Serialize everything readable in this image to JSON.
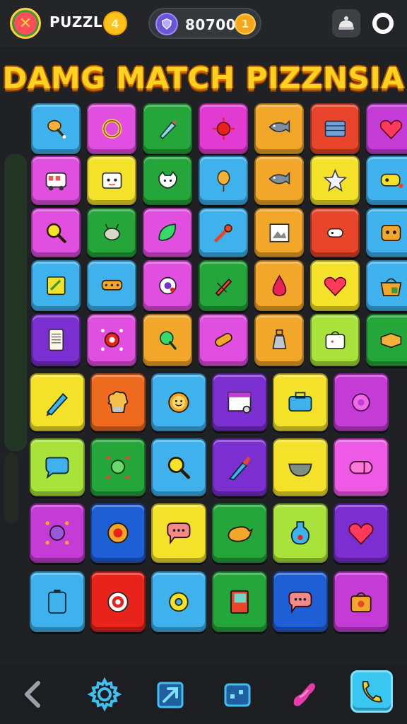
{
  "header": {
    "app_title": "PUZZL",
    "title_coin": "4",
    "score": "80700",
    "score_coin": "1",
    "logo_icon": "crossed-swords-icon",
    "gem_icon": "gem-shield-icon",
    "robot_icon": "robot-icon",
    "ring_icon": "ring-icon"
  },
  "game_title": "DAMG MATCH PIZZNSIA",
  "board": {
    "rows": [
      [
        {
          "color": "#3fb2ee",
          "icon": "drumstick"
        },
        {
          "color": "#e04fe0",
          "icon": "ring"
        },
        {
          "color": "#25a63a",
          "icon": "rocket"
        },
        {
          "color": "#e23bd2",
          "icon": "virus"
        },
        {
          "color": "#f2a72a",
          "icon": "fish"
        },
        {
          "color": "#e8452b",
          "icon": "keyboard"
        },
        {
          "color": "#c53bd6",
          "icon": "heart"
        }
      ],
      [
        {
          "color": "#e04fe0",
          "icon": "bus"
        },
        {
          "color": "#f4e22a",
          "icon": "face-box"
        },
        {
          "color": "#25a63a",
          "icon": "cat-face"
        },
        {
          "color": "#3fb2ee",
          "icon": "balloon"
        },
        {
          "color": "#f2a72a",
          "icon": "fish"
        },
        {
          "color": "#f4e22a",
          "icon": "star"
        },
        {
          "color": "#3fb2ee",
          "icon": "robot-car"
        }
      ],
      [
        {
          "color": "#e04fe0",
          "icon": "magnifier"
        },
        {
          "color": "#25a63a",
          "icon": "alien-bug"
        },
        {
          "color": "#e04fe0",
          "icon": "leaf"
        },
        {
          "color": "#3fb2ee",
          "icon": "wrench"
        },
        {
          "color": "#f2a72a",
          "icon": "picture"
        },
        {
          "color": "#e8452b",
          "icon": "bone"
        },
        {
          "color": "#3fb2ee",
          "icon": "robot-face"
        }
      ],
      [
        {
          "color": "#3fb2ee",
          "icon": "card"
        },
        {
          "color": "#3fb2ee",
          "icon": "bed"
        },
        {
          "color": "#e04fe0",
          "icon": "eyeball"
        },
        {
          "color": "#25a63a",
          "icon": "pencil"
        },
        {
          "color": "#f2a72a",
          "icon": "drop"
        },
        {
          "color": "#f4e22a",
          "icon": "heart"
        },
        {
          "color": "#3fb2ee",
          "icon": "basket"
        }
      ],
      [
        {
          "color": "#7b2fd0",
          "icon": "phone"
        },
        {
          "color": "#e04fe0",
          "icon": "donut-bones"
        },
        {
          "color": "#f2a72a",
          "icon": "green-pin"
        },
        {
          "color": "#e04fe0",
          "icon": "bandage"
        },
        {
          "color": "#f2a72a",
          "icon": "bottle"
        },
        {
          "color": "#a8e23a",
          "icon": "bag"
        },
        {
          "color": "#25a63a",
          "icon": "box"
        }
      ],
      [
        {
          "color": "#f4e22a",
          "icon": "crayon"
        },
        {
          "color": "#ee6a1f",
          "icon": "chef-hat"
        },
        {
          "color": "#3fb2ee",
          "icon": "smiley"
        },
        {
          "color": "#7b2fd0",
          "icon": "canvas"
        },
        {
          "color": "#f4e22a",
          "icon": "suitcase"
        },
        {
          "color": "#c53bd6",
          "icon": "gear"
        }
      ],
      [
        {
          "color": "#a8e23a",
          "icon": "chat-bubble"
        },
        {
          "color": "#25a63a",
          "icon": "virus-skull"
        },
        {
          "color": "#3fb2ee",
          "icon": "magnifier"
        },
        {
          "color": "#7b2fd0",
          "icon": "brush"
        },
        {
          "color": "#f4e22a",
          "icon": "bowl"
        },
        {
          "color": "#ee5ae6",
          "icon": "capsule"
        }
      ],
      [
        {
          "color": "#c53bd6",
          "icon": "spiky-face"
        },
        {
          "color": "#1f5fd6",
          "icon": "sun-badge"
        },
        {
          "color": "#f4e22a",
          "icon": "speech-bubble"
        },
        {
          "color": "#25a63a",
          "icon": "bird"
        },
        {
          "color": "#a8e23a",
          "icon": "potion"
        },
        {
          "color": "#7b2fd0",
          "icon": "heart"
        }
      ],
      [
        {
          "color": "#3fb2ee",
          "icon": "battery"
        },
        {
          "color": "#e8231b",
          "icon": "ring-target"
        },
        {
          "color": "#3fb2ee",
          "icon": "donut"
        },
        {
          "color": "#25a63a",
          "icon": "notebook"
        },
        {
          "color": "#1f5fd6",
          "icon": "speech-bubble"
        },
        {
          "color": "#c53bd6",
          "icon": "camera-bag"
        }
      ]
    ]
  },
  "bottom_bar": {
    "items": [
      {
        "name": "back-icon"
      },
      {
        "name": "settings-icon"
      },
      {
        "name": "share-icon"
      },
      {
        "name": "inventory-icon"
      },
      {
        "name": "magnet-icon"
      },
      {
        "name": "phone-icon"
      }
    ]
  }
}
